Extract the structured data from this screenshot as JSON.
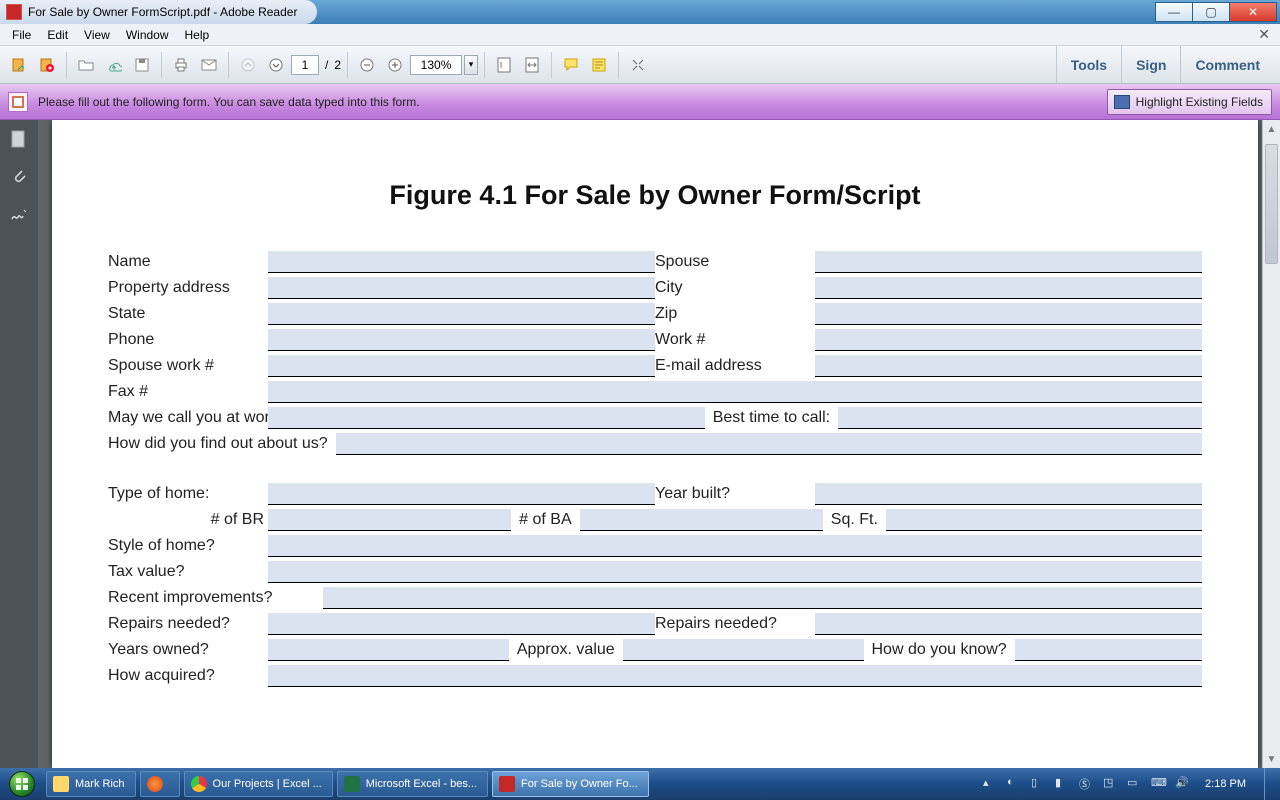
{
  "window": {
    "title": "For Sale by Owner FormScript.pdf - Adobe Reader",
    "min": "—",
    "max": "▭",
    "close": "X"
  },
  "menubar": [
    "File",
    "Edit",
    "View",
    "Window",
    "Help"
  ],
  "toolbar": {
    "page_current": "1",
    "page_sep": "/",
    "page_total": "2",
    "zoom": "130%"
  },
  "panel_btns": {
    "tools": "Tools",
    "sign": "Sign",
    "comment": "Comment"
  },
  "formbar": {
    "msg": "Please fill out the following form. You can save data typed into this form.",
    "hl_btn": "Highlight Existing Fields"
  },
  "doc": {
    "title": "Figure 4.1 For Sale by Owner Form/Script",
    "labels": {
      "name": "Name",
      "spouse": "Spouse",
      "prop_addr": "Property address",
      "city": "City",
      "state": "State",
      "zip": "Zip",
      "phone": "Phone",
      "work": "Work #",
      "spouse_work": "Spouse work #",
      "email": "E-mail address",
      "fax": "Fax #",
      "may_call": "May we call you at work?",
      "best_time": "Best time to call:",
      "found_us": "How did you find out about us?",
      "type_home": "Type of home:",
      "year_built": "Year built?",
      "num_br": "# of BR",
      "num_ba": "# of BA",
      "sqft": "Sq. Ft.",
      "style": "Style of home?",
      "tax": "Tax value?",
      "recent_imp": "Recent improvements?",
      "repairs": "Repairs needed?",
      "repairs2": "Repairs needed?",
      "years_owned": "Years owned?",
      "approx_val": "Approx. value",
      "how_know": "How do you know?",
      "how_acq": "How acquired?"
    }
  },
  "taskbar": {
    "tasks": [
      {
        "label": "Mark Rich"
      },
      {
        "label": ""
      },
      {
        "label": "Our Projects | Excel ..."
      },
      {
        "label": "Microsoft Excel - bes..."
      },
      {
        "label": "For Sale by Owner Fo..."
      }
    ],
    "clock": "2:18 PM"
  }
}
